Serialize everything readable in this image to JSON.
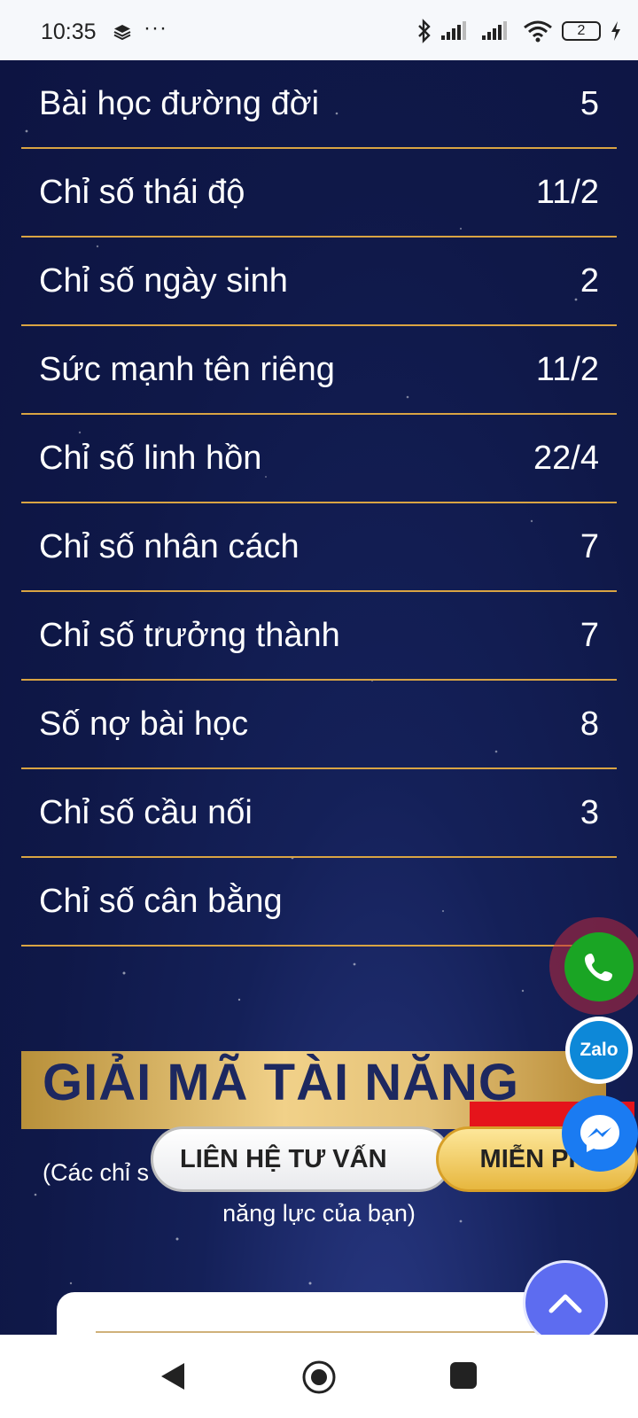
{
  "status_bar": {
    "time": "10:35",
    "dots": "···",
    "battery": "2",
    "icons": [
      "layers-icon",
      "bluetooth-icon",
      "signal-icon",
      "signal-icon",
      "wifi-icon",
      "battery-icon",
      "charging-icon"
    ]
  },
  "numerology": {
    "rows": [
      {
        "label": "Bài học đường đời",
        "value": "5"
      },
      {
        "label": "Chỉ số thái độ",
        "value": "11/2"
      },
      {
        "label": "Chỉ số ngày sinh",
        "value": "2"
      },
      {
        "label": "Sức mạnh tên riêng",
        "value": "11/2"
      },
      {
        "label": "Chỉ số linh hồn",
        "value": "22/4"
      },
      {
        "label": "Chỉ số nhân cách",
        "value": "7"
      },
      {
        "label": "Chỉ số trưởng thành",
        "value": "7"
      },
      {
        "label": "Số nợ bài học",
        "value": "8"
      },
      {
        "label": "Chỉ số cầu nối",
        "value": "3"
      },
      {
        "label": "Chỉ số cân bằng",
        "value": ""
      }
    ]
  },
  "talent_section": {
    "title": "GIẢI MÃ TÀI NĂNG",
    "subtitle_line1": "(Các chỉ s",
    "subtitle_line2": "năng lực của bạn)"
  },
  "cta": {
    "contact_label": "LIÊN HỆ TƯ VẤN",
    "free_label": "MIỄN PHÍ"
  },
  "floating_buttons": {
    "zalo_label": "Zalo"
  },
  "colors": {
    "background": "#101a4a",
    "divider": "#d9a443",
    "gold": "#e9c67b",
    "phone_green": "#1aa524",
    "messenger_blue": "#1a7bf2",
    "scroll_top": "#5d6cf0"
  }
}
